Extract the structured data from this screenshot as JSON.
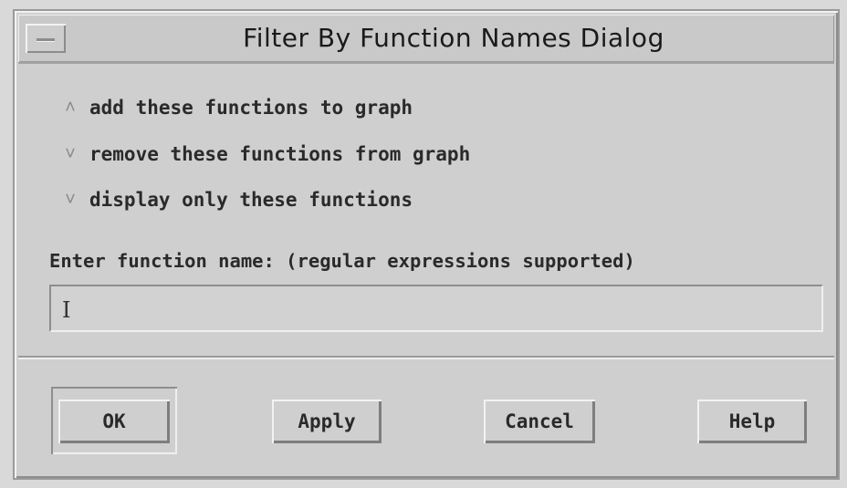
{
  "dialog": {
    "title": "Filter By Function Names Dialog"
  },
  "options": [
    {
      "label": "add these functions to graph",
      "selected": true
    },
    {
      "label": "remove these functions from graph",
      "selected": false
    },
    {
      "label": "display only these functions",
      "selected": false
    }
  ],
  "input": {
    "label": "Enter function name: (regular expressions supported)",
    "value": ""
  },
  "buttons": {
    "ok": "OK",
    "apply": "Apply",
    "cancel": "Cancel",
    "help": "Help"
  }
}
